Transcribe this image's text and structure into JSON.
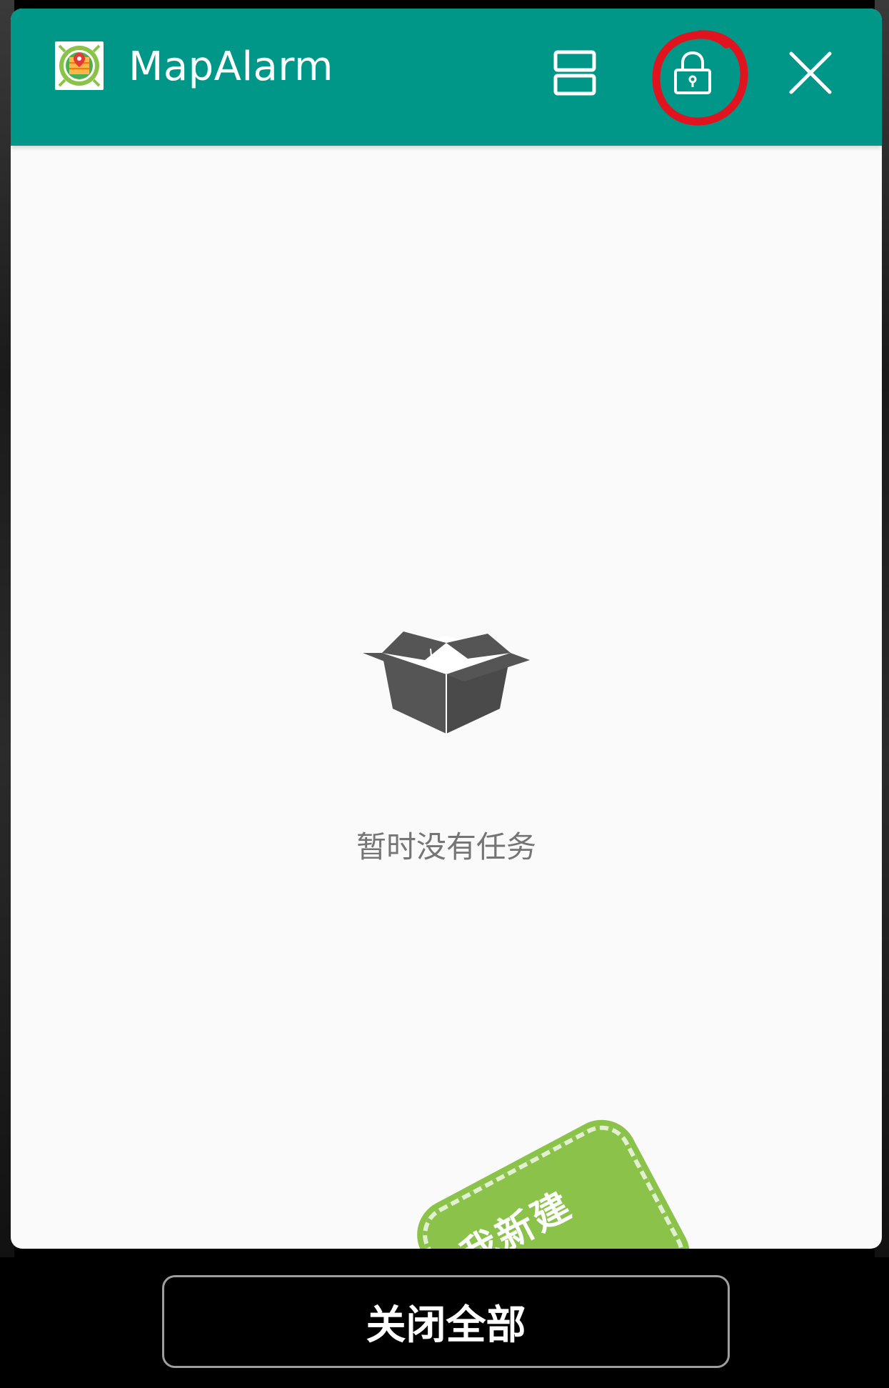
{
  "window": {
    "app_title": "MapAlarm",
    "icons": {
      "app": "map-alarm-app-icon",
      "split": "split-window-icon",
      "lock": "lock-icon",
      "close": "close-icon"
    },
    "annotation": "red-circle-highlight"
  },
  "empty_state": {
    "icon": "open-box-icon",
    "message": "暂时没有任务"
  },
  "floating_badge": {
    "label": "我新建"
  },
  "bottom_bar": {
    "close_all_label": "关闭全部"
  },
  "colors": {
    "accent": "#009688",
    "badge": "#8bc34a",
    "annotation": "#e0141e"
  }
}
